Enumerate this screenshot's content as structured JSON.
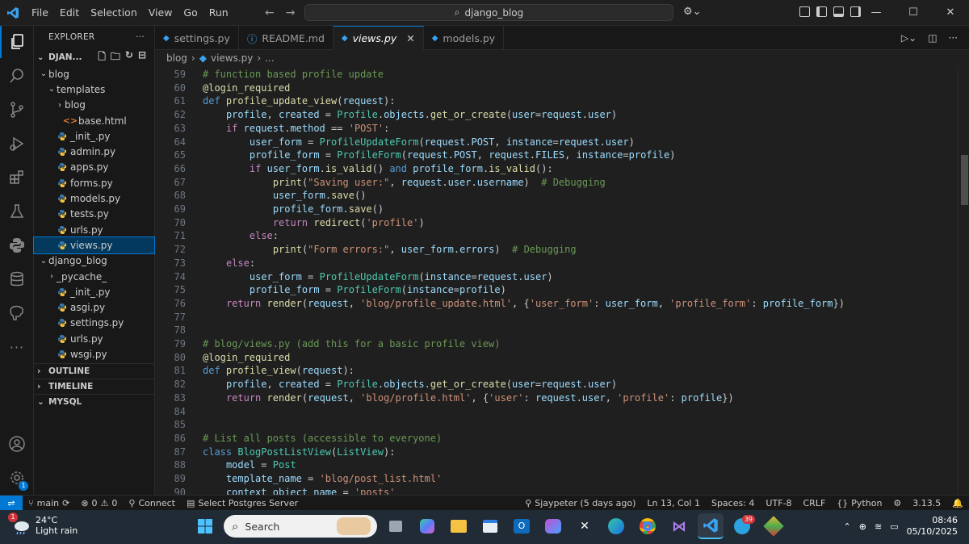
{
  "window": {
    "menu": [
      "File",
      "Edit",
      "Selection",
      "View",
      "Go",
      "Run"
    ],
    "search_text": "django_blog"
  },
  "sidebar": {
    "header": "EXPLORER",
    "root": "DJAN...",
    "tree": [
      {
        "label": "blog",
        "kind": "folder-open",
        "depth": 0
      },
      {
        "label": "templates",
        "kind": "folder-open",
        "depth": 1
      },
      {
        "label": "blog",
        "kind": "folder-closed",
        "depth": 2
      },
      {
        "label": "base.html",
        "kind": "html",
        "depth": 2
      },
      {
        "label": "_init_.py",
        "kind": "py",
        "depth": 1
      },
      {
        "label": "admin.py",
        "kind": "py",
        "depth": 1
      },
      {
        "label": "apps.py",
        "kind": "py",
        "depth": 1
      },
      {
        "label": "forms.py",
        "kind": "py",
        "depth": 1
      },
      {
        "label": "models.py",
        "kind": "py",
        "depth": 1
      },
      {
        "label": "tests.py",
        "kind": "py",
        "depth": 1
      },
      {
        "label": "urls.py",
        "kind": "py",
        "depth": 1
      },
      {
        "label": "views.py",
        "kind": "py",
        "depth": 1,
        "selected": true
      },
      {
        "label": "django_blog",
        "kind": "folder-open",
        "depth": 0
      },
      {
        "label": "_pycache_",
        "kind": "folder-closed",
        "depth": 1
      },
      {
        "label": "_init_.py",
        "kind": "py",
        "depth": 1
      },
      {
        "label": "asgi.py",
        "kind": "py",
        "depth": 1
      },
      {
        "label": "settings.py",
        "kind": "py",
        "depth": 1
      },
      {
        "label": "urls.py",
        "kind": "py",
        "depth": 1
      },
      {
        "label": "wsgi.py",
        "kind": "py",
        "depth": 1
      }
    ],
    "sections": [
      "OUTLINE",
      "TIMELINE",
      "MYSQL"
    ]
  },
  "tabs": [
    {
      "label": "settings.py",
      "icon": "python-icon"
    },
    {
      "label": "README.md",
      "icon": "info-icon"
    },
    {
      "label": "views.py",
      "icon": "python-icon",
      "active": true
    },
    {
      "label": "models.py",
      "icon": "python-icon"
    }
  ],
  "breadcrumb": [
    "blog",
    "views.py",
    "..."
  ],
  "code": [
    {
      "n": "59",
      "t": "# function based profile update"
    },
    {
      "n": "60",
      "t": "@login_required"
    },
    {
      "n": "61",
      "t": "def profile_update_view(request):"
    },
    {
      "n": "62",
      "t": "    profile, created = Profile.objects.get_or_create(user=request.user)"
    },
    {
      "n": "63",
      "t": "    if request.method == 'POST':"
    },
    {
      "n": "64",
      "t": "        user_form = ProfileUpdateForm(request.POST, instance=request.user)"
    },
    {
      "n": "65",
      "t": "        profile_form = ProfileForm(request.POST, request.FILES, instance=profile)"
    },
    {
      "n": "66",
      "t": "        if user_form.is_valid() and profile_form.is_valid():"
    },
    {
      "n": "67",
      "t": "            print(\"Saving user:\", request.user.username)  # Debugging"
    },
    {
      "n": "68",
      "t": "            user_form.save()"
    },
    {
      "n": "69",
      "t": "            profile_form.save()"
    },
    {
      "n": "70",
      "t": "            return redirect('profile')"
    },
    {
      "n": "71",
      "t": "        else:"
    },
    {
      "n": "72",
      "t": "            print(\"Form errors:\", user_form.errors)  # Debugging"
    },
    {
      "n": "73",
      "t": "    else:"
    },
    {
      "n": "74",
      "t": "        user_form = ProfileUpdateForm(instance=request.user)"
    },
    {
      "n": "75",
      "t": "        profile_form = ProfileForm(instance=profile)"
    },
    {
      "n": "76",
      "t": "    return render(request, 'blog/profile_update.html', {'user_form': user_form, 'profile_form': profile_form})"
    },
    {
      "n": "77",
      "t": ""
    },
    {
      "n": "78",
      "t": ""
    },
    {
      "n": "79",
      "t": "# blog/views.py (add this for a basic profile view)"
    },
    {
      "n": "80",
      "t": "@login_required"
    },
    {
      "n": "81",
      "t": "def profile_view(request):"
    },
    {
      "n": "82",
      "t": "    profile, created = Profile.objects.get_or_create(user=request.user)"
    },
    {
      "n": "83",
      "t": "    return render(request, 'blog/profile.html', {'user': request.user, 'profile': profile})"
    },
    {
      "n": "84",
      "t": ""
    },
    {
      "n": "85",
      "t": ""
    },
    {
      "n": "86",
      "t": "# List all posts (accessible to everyone)"
    },
    {
      "n": "87",
      "t": "class BlogPostListView(ListView):"
    },
    {
      "n": "88",
      "t": "    model = Post"
    },
    {
      "n": "89",
      "t": "    template_name = 'blog/post_list.html'"
    },
    {
      "n": "90",
      "t": "    context_object_name = 'posts'"
    }
  ],
  "status": {
    "branch": "main",
    "errors": "0",
    "warnings": "0",
    "connect": "Connect",
    "postgres": "Select Postgres Server",
    "blame": "Sjaypeter (5 days ago)",
    "position": "Ln 13, Col 1",
    "spaces": "Spaces: 4",
    "encoding": "UTF-8",
    "eol": "CRLF",
    "language": "Python",
    "python_version": "3.13.5"
  },
  "taskbar": {
    "temp": "24°C",
    "weather": "Light rain",
    "weather_badge": "1",
    "search": "Search",
    "telegram_badge": "39",
    "time": "08:46",
    "date": "05/10/2025"
  },
  "activity_badge": "1",
  "colors": {
    "accent": "#0078d4",
    "keyword": "#569cd6",
    "control": "#c586c0",
    "function": "#dcdcaa",
    "class": "#4ec9b0",
    "string": "#ce9178",
    "comment": "#6a9955",
    "variable": "#9cdcfe"
  }
}
